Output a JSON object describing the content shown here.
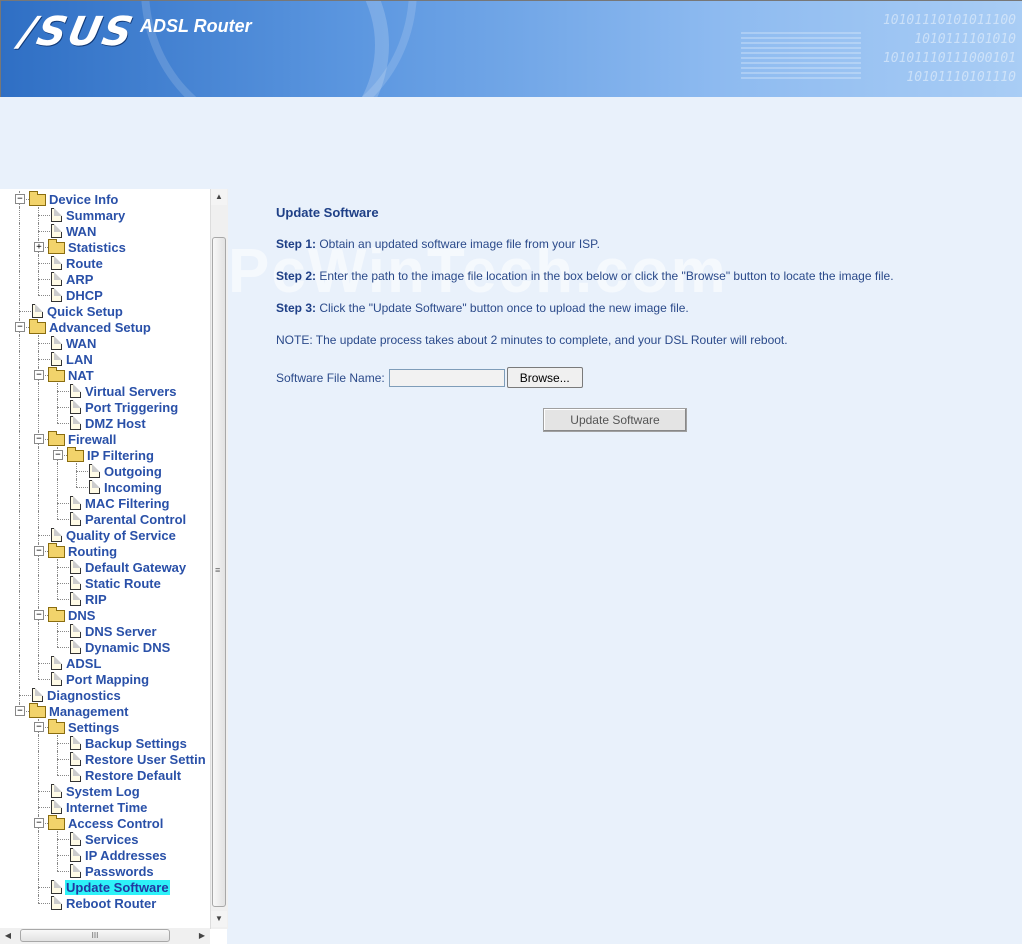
{
  "header": {
    "logo": "/SUS",
    "product": "ADSL Router",
    "binary_lines": [
      "10101110101011100",
      "1010111101010",
      "10101110111000101",
      "10101110101110"
    ]
  },
  "tree": {
    "items": [
      {
        "label": "Device Info",
        "type": "folder",
        "level": 1,
        "expanded": true
      },
      {
        "label": "Summary",
        "type": "doc",
        "level": 2
      },
      {
        "label": "WAN",
        "type": "doc",
        "level": 2
      },
      {
        "label": "Statistics",
        "type": "folder",
        "level": 2,
        "expanded": false
      },
      {
        "label": "Route",
        "type": "doc",
        "level": 2
      },
      {
        "label": "ARP",
        "type": "doc",
        "level": 2
      },
      {
        "label": "DHCP",
        "type": "doc",
        "level": 2
      },
      {
        "label": "Quick Setup",
        "type": "doc",
        "level": 1
      },
      {
        "label": "Advanced Setup",
        "type": "folder",
        "level": 1,
        "expanded": true
      },
      {
        "label": "WAN",
        "type": "doc",
        "level": 2
      },
      {
        "label": "LAN",
        "type": "doc",
        "level": 2
      },
      {
        "label": "NAT",
        "type": "folder",
        "level": 2,
        "expanded": true
      },
      {
        "label": "Virtual Servers",
        "type": "doc",
        "level": 3
      },
      {
        "label": "Port Triggering",
        "type": "doc",
        "level": 3
      },
      {
        "label": "DMZ Host",
        "type": "doc",
        "level": 3
      },
      {
        "label": "Firewall",
        "type": "folder",
        "level": 2,
        "expanded": true
      },
      {
        "label": "IP Filtering",
        "type": "folder",
        "level": 3,
        "expanded": true
      },
      {
        "label": "Outgoing",
        "type": "doc",
        "level": 4
      },
      {
        "label": "Incoming",
        "type": "doc",
        "level": 4
      },
      {
        "label": "MAC Filtering",
        "type": "doc",
        "level": 3
      },
      {
        "label": "Parental Control",
        "type": "doc",
        "level": 3
      },
      {
        "label": "Quality of Service",
        "type": "doc",
        "level": 2
      },
      {
        "label": "Routing",
        "type": "folder",
        "level": 2,
        "expanded": true
      },
      {
        "label": "Default Gateway",
        "type": "doc",
        "level": 3
      },
      {
        "label": "Static Route",
        "type": "doc",
        "level": 3
      },
      {
        "label": "RIP",
        "type": "doc",
        "level": 3
      },
      {
        "label": "DNS",
        "type": "folder",
        "level": 2,
        "expanded": true
      },
      {
        "label": "DNS Server",
        "type": "doc",
        "level": 3
      },
      {
        "label": "Dynamic DNS",
        "type": "doc",
        "level": 3
      },
      {
        "label": "ADSL",
        "type": "doc",
        "level": 2
      },
      {
        "label": "Port Mapping",
        "type": "doc",
        "level": 2
      },
      {
        "label": "Diagnostics",
        "type": "doc",
        "level": 1
      },
      {
        "label": "Management",
        "type": "folder",
        "level": 1,
        "expanded": true
      },
      {
        "label": "Settings",
        "type": "folder",
        "level": 2,
        "expanded": true
      },
      {
        "label": "Backup Settings",
        "type": "doc",
        "level": 3
      },
      {
        "label": "Restore User Settin",
        "type": "doc",
        "level": 3
      },
      {
        "label": "Restore Default",
        "type": "doc",
        "level": 3
      },
      {
        "label": "System Log",
        "type": "doc",
        "level": 2
      },
      {
        "label": "Internet Time",
        "type": "doc",
        "level": 2
      },
      {
        "label": "Access Control",
        "type": "folder",
        "level": 2,
        "expanded": true
      },
      {
        "label": "Services",
        "type": "doc",
        "level": 3
      },
      {
        "label": "IP Addresses",
        "type": "doc",
        "level": 3
      },
      {
        "label": "Passwords",
        "type": "doc",
        "level": 3
      },
      {
        "label": "Update Software",
        "type": "doc",
        "level": 2,
        "selected": true
      },
      {
        "label": "Reboot Router",
        "type": "doc",
        "level": 2
      }
    ]
  },
  "main": {
    "watermark": "PcWinTech.com",
    "title": "Update Software",
    "steps": [
      {
        "prefix": "Step 1:",
        "text": " Obtain an updated software image file from your ISP."
      },
      {
        "prefix": "Step 2:",
        "text": " Enter the path to the image file location in the box below or click the \"Browse\" button to locate the image file."
      },
      {
        "prefix": "Step 3:",
        "text": " Click the \"Update Software\" button once to upload the new image file."
      }
    ],
    "note": "NOTE: The update process takes about 2 minutes to complete, and your DSL Router will reboot.",
    "file_label": "Software File Name:",
    "file_value": "",
    "browse_label": "Browse...",
    "update_label": "Update Software"
  },
  "colors": {
    "link": "#2950a8",
    "selected_bg": "#2ef2f8",
    "page_bg": "#e9f1fb"
  }
}
